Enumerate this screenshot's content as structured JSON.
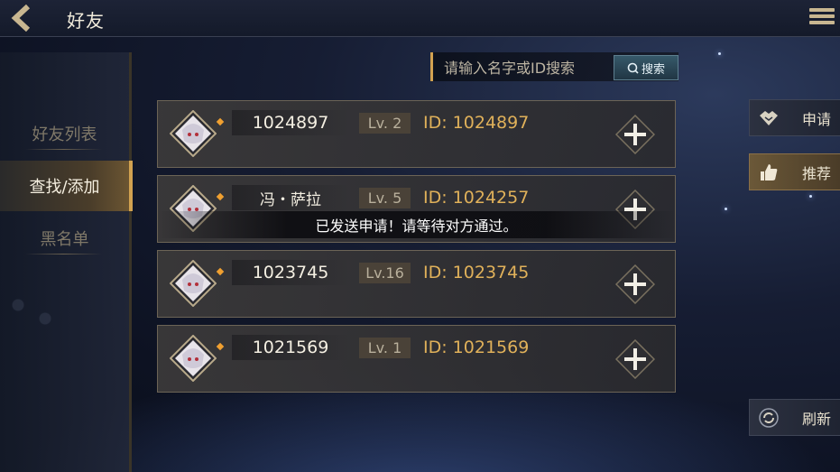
{
  "header": {
    "title": "好友"
  },
  "leftnav": {
    "items": [
      {
        "label": "好友列表",
        "active": false
      },
      {
        "label": "查找/添加",
        "active": true
      },
      {
        "label": "黑名单",
        "active": false
      }
    ]
  },
  "search": {
    "placeholder": "请输入名字或ID搜索",
    "value": "",
    "button_label": "搜索"
  },
  "friends": [
    {
      "name": "1024897",
      "level": "Lv. 2",
      "id": "ID: 1024897"
    },
    {
      "name": "冯・萨拉",
      "level": "Lv. 5",
      "id": "ID: 1024257"
    },
    {
      "name": "1023745",
      "level": "Lv.16",
      "id": "ID: 1023745"
    },
    {
      "name": "1021569",
      "level": "Lv. 1",
      "id": "ID: 1021569"
    }
  ],
  "toast": {
    "message": "已发送申请！请等待对方通过。"
  },
  "right_actions": {
    "apply_label": "申请",
    "recommend_label": "推荐",
    "refresh_label": "刷新"
  },
  "colors": {
    "accent_gold": "#d2a250",
    "id_text": "#e0b15a",
    "dot": "#f0a030"
  }
}
